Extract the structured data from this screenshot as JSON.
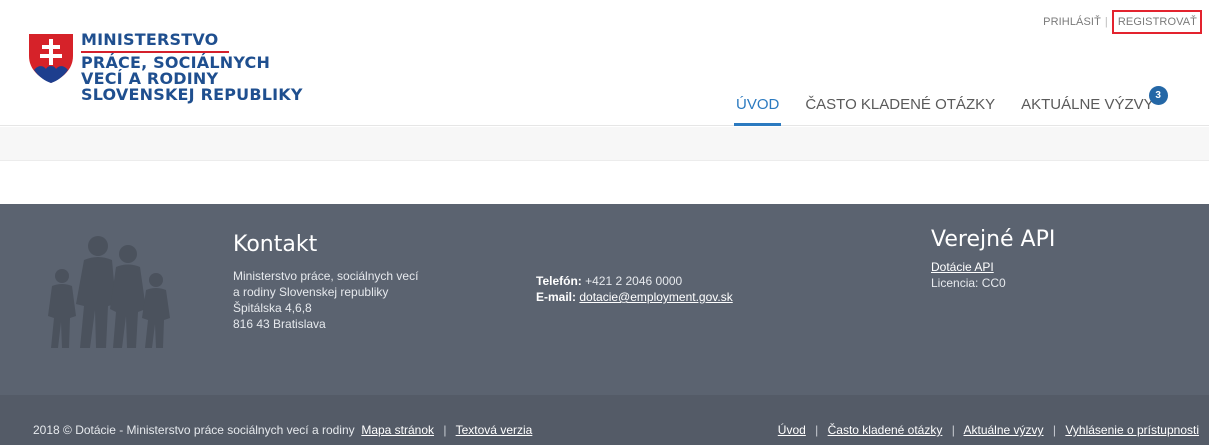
{
  "header": {
    "logo": {
      "line1": "MINISTERSTVO",
      "line2": "PRÁCE, SOCIÁLNYCH",
      "line3": "VECÍ A RODINY",
      "line4": "SLOVENSKEJ REPUBLIKY",
      "crest_icon": "slovak-crest-icon"
    },
    "top_links": {
      "login": "PRIHLÁSIŤ",
      "separator": "|",
      "register": "REGISTROVAŤ"
    },
    "nav": {
      "items": [
        {
          "label": "ÚVOD"
        },
        {
          "label": "ČASTO KLADENÉ OTÁZKY"
        },
        {
          "label": "AKTUÁLNE VÝZVY"
        }
      ],
      "badge": "3"
    }
  },
  "footer": {
    "family_icon": "family-icon",
    "contact": {
      "heading": "Kontakt",
      "address": [
        "Ministerstvo práce, sociálnych vecí",
        "a rodiny Slovenskej republiky",
        "Špitálska 4,6,8",
        "816 43 Bratislava"
      ],
      "phone_label": "Telefón:",
      "phone": "+421 2 2046 0000",
      "email_label": "E-mail:",
      "email": "dotacie@employment.gov.sk"
    },
    "api": {
      "heading": "Verejné API",
      "link": "Dotácie API",
      "license": "Licencia: CC0"
    },
    "bottom": {
      "copyright": "2018 © Dotácie - Ministerstvo práce sociálnych vecí a rodiny",
      "sitemap": "Mapa stránok",
      "separator": "|",
      "text_version": "Textová verzia",
      "links": [
        "Úvod",
        "Často kladené otázky",
        "Aktuálne výzvy",
        "Vyhlásenie o prístupnosti"
      ]
    }
  },
  "colors": {
    "brand_blue": "#1f4f8f",
    "brand_red": "#d4202b",
    "nav_active": "#2b7ac0",
    "footer_bg": "#5b6370"
  }
}
